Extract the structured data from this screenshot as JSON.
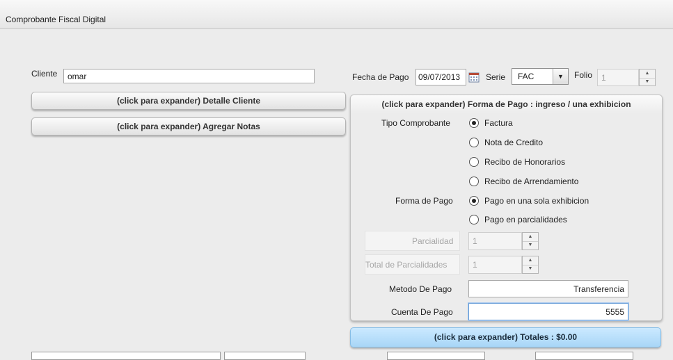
{
  "window": {
    "title": "Comprobante Fiscal Digital"
  },
  "cliente": {
    "label": "Cliente",
    "value": "omar"
  },
  "buttons": {
    "detalle_cliente": "(click para expander) Detalle Cliente",
    "agregar_notas": "(click para expander) Agregar Notas",
    "totales": "(click para expander) Totales : $0.00"
  },
  "pago": {
    "fecha_label": "Fecha de Pago",
    "fecha_value": "09/07/2013",
    "serie_label": "Serie",
    "serie_value": "FAC",
    "folio_label": "Folio",
    "folio_value": "1"
  },
  "forma_pago_panel": {
    "header": "(click para expander) Forma de Pago : ingreso / una exhibicion",
    "tipo_label": "Tipo Comprobante",
    "tipo_options": [
      "Factura",
      "Nota de Credito",
      "Recibo de Honorarios",
      "Recibo de Arrendamiento"
    ],
    "tipo_selected": "Factura",
    "forma_label": "Forma de Pago",
    "forma_options": [
      "Pago en una sola exhibicion",
      "Pago en parcialidades"
    ],
    "forma_selected": "Pago en una sola exhibicion",
    "parcialidad_label": "Parcialidad",
    "parcialidad_value": "1",
    "total_parcialidades_label": "Total de Parcialidades",
    "total_parcialidades_value": "1",
    "metodo_label": "Metodo De Pago",
    "metodo_value": "Transferencia",
    "cuenta_label": "Cuenta De Pago",
    "cuenta_value": "5555"
  },
  "colors": {
    "accent_blue": "#a8d6f7",
    "focus_border": "#6a9fd8"
  }
}
